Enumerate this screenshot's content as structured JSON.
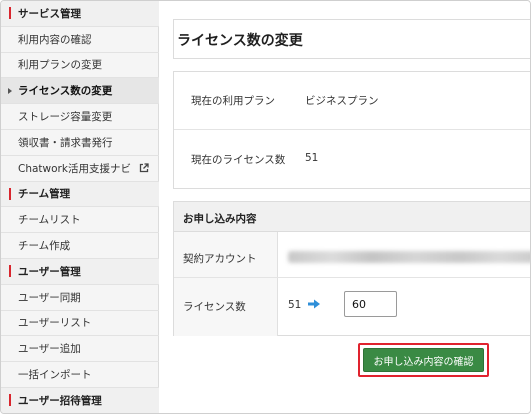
{
  "sidebar": {
    "items": [
      {
        "type": "section",
        "label": "サービス管理"
      },
      {
        "type": "link",
        "label": "利用内容の確認"
      },
      {
        "type": "link",
        "label": "利用プランの変更"
      },
      {
        "type": "active",
        "label": "ライセンス数の変更"
      },
      {
        "type": "link",
        "label": "ストレージ容量変更"
      },
      {
        "type": "link",
        "label": "領収書・請求書発行"
      },
      {
        "type": "link",
        "label": "Chatwork活用支援ナビ",
        "icon": "external-link-icon"
      },
      {
        "type": "section",
        "label": "チーム管理"
      },
      {
        "type": "link",
        "label": "チームリスト"
      },
      {
        "type": "link",
        "label": "チーム作成"
      },
      {
        "type": "section",
        "label": "ユーザー管理"
      },
      {
        "type": "link",
        "label": "ユーザー同期"
      },
      {
        "type": "link",
        "label": "ユーザーリスト"
      },
      {
        "type": "link",
        "label": "ユーザー追加"
      },
      {
        "type": "link",
        "label": "一括インポート"
      },
      {
        "type": "section",
        "label": "ユーザー招待管理"
      }
    ]
  },
  "main": {
    "title": "ライセンス数の変更",
    "current_plan_label": "現在の利用プラン",
    "current_plan_value": "ビジネスプラン",
    "current_license_label": "現在のライセンス数",
    "current_license_value": "51",
    "order": {
      "heading": "お申し込み内容",
      "account_label": "契約アカウント",
      "license_label": "ライセンス数",
      "license_old": "51",
      "license_new": "60"
    },
    "confirm_button": "お申し込み内容の確認"
  },
  "colors": {
    "section_marker": "#d8262e",
    "arrow": "#2f8fd8",
    "confirm_button": "#3a8a44",
    "highlight_outline": "#e0232e"
  }
}
